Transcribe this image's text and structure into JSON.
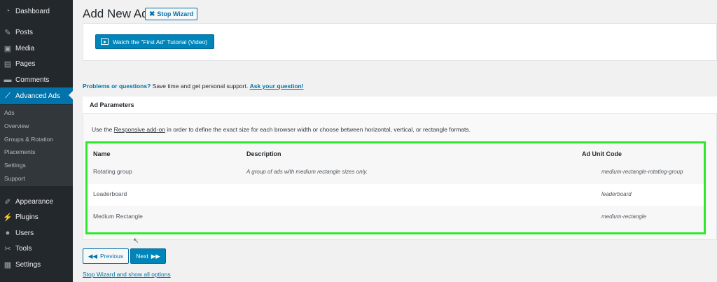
{
  "sidebar": {
    "menu": [
      {
        "label": "Dashboard",
        "icon": "dashboard-icon",
        "glyph": "◔"
      },
      {
        "label": "Posts",
        "icon": "pin-icon",
        "glyph": "✎"
      },
      {
        "label": "Media",
        "icon": "media-icon",
        "glyph": "▣"
      },
      {
        "label": "Pages",
        "icon": "pages-icon",
        "glyph": "▤"
      },
      {
        "label": "Comments",
        "icon": "comments-icon",
        "glyph": "▬"
      },
      {
        "label": "Advanced Ads",
        "icon": "chart-icon",
        "glyph": "⟋"
      }
    ],
    "submenu": [
      "Ads",
      "Overview",
      "Groups & Rotation",
      "Placements",
      "Settings",
      "Support"
    ],
    "menu2": [
      {
        "label": "Appearance",
        "icon": "brush-icon",
        "glyph": "✐"
      },
      {
        "label": "Plugins",
        "icon": "plug-icon",
        "glyph": "⚡"
      },
      {
        "label": "Users",
        "icon": "users-icon",
        "glyph": "●"
      },
      {
        "label": "Tools",
        "icon": "wrench-icon",
        "glyph": "✂"
      },
      {
        "label": "Settings",
        "icon": "settings-icon",
        "glyph": "▦"
      }
    ]
  },
  "page": {
    "title": "Add New Ad",
    "stop_wizard": "Stop Wizard",
    "video_button": "Watch the \"First Ad\" Tutorial (Video)",
    "problems_bold": "Problems or questions?",
    "problems_text": " Save time and get personal support. ",
    "problems_link": "Ask your question!"
  },
  "params": {
    "title": "Ad Parameters",
    "desc_pre": "Use the ",
    "desc_link": "Responsive add-on",
    "desc_post": " in order to define the exact size for each browser width or choose between horizontal, vertical, or rectangle formats.",
    "headers": {
      "name": "Name",
      "description": "Description",
      "code": "Ad Unit Code"
    },
    "rows": [
      {
        "name": "Rotating group",
        "description": "A group of ads with medium rectangle sizes only.",
        "code": "medium-rectangle-rotating-group"
      },
      {
        "name": "Leaderboard",
        "description": "",
        "code": "leaderboard"
      },
      {
        "name": "Medium Rectangle",
        "description": "",
        "code": "medium-rectangle"
      }
    ]
  },
  "footer": {
    "previous": "Previous",
    "next": "Next",
    "stop_link": "Stop Wizard and show all options"
  },
  "colors": {
    "accent": "#0073aa",
    "highlight": "#2ee82e",
    "sidebar": "#23282d"
  }
}
